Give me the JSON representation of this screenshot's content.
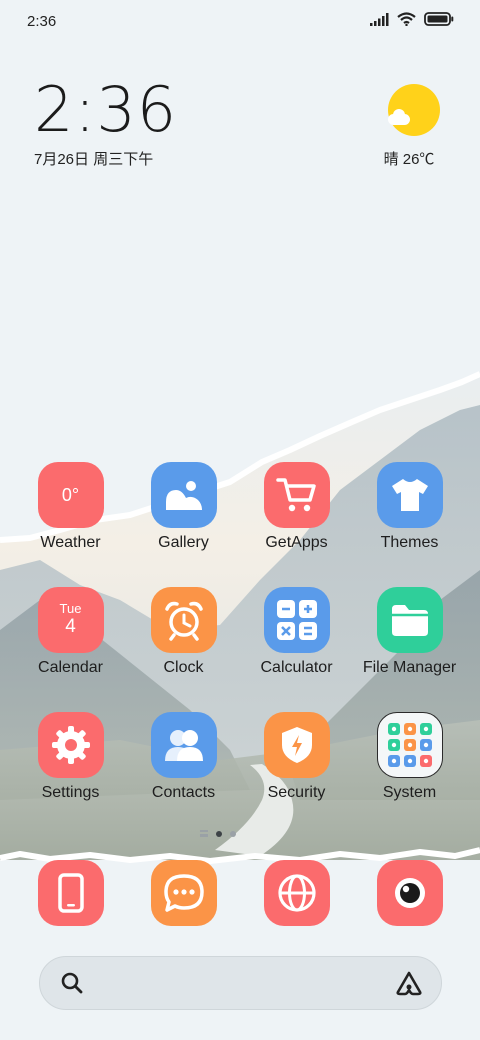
{
  "status": {
    "time": "2:36"
  },
  "clock": {
    "time": "2:36",
    "date": "7月26日 周三下午"
  },
  "weather": {
    "text": "晴 26℃"
  },
  "apps": [
    {
      "label": "Weather",
      "icon": "weather-app-icon",
      "color": "#fb6b6d",
      "badge": "0°"
    },
    {
      "label": "Gallery",
      "icon": "gallery-icon",
      "color": "#5a9bea"
    },
    {
      "label": "GetApps",
      "icon": "shopping-cart-icon",
      "color": "#fb6b6d"
    },
    {
      "label": "Themes",
      "icon": "tshirt-icon",
      "color": "#5a9bea"
    },
    {
      "label": "Calendar",
      "icon": "calendar-icon",
      "color": "#fb6b6d",
      "day": "Tue",
      "date": "4"
    },
    {
      "label": "Clock",
      "icon": "alarm-clock-icon",
      "color": "#fb9447"
    },
    {
      "label": "Calculator",
      "icon": "calculator-icon",
      "color": "#5a9bea"
    },
    {
      "label": "File Manager",
      "icon": "folder-icon",
      "color": "#2fcf9a"
    },
    {
      "label": "Settings",
      "icon": "gear-icon",
      "color": "#fb6b6d"
    },
    {
      "label": "Contacts",
      "icon": "contacts-icon",
      "color": "#5a9bea"
    },
    {
      "label": "Security",
      "icon": "shield-icon",
      "color": "#fb9447"
    },
    {
      "label": "System",
      "icon": "folder-grid-icon",
      "color": "#f4f7f8"
    }
  ],
  "dock": [
    {
      "icon": "phone-icon",
      "color": "#fb6b6d"
    },
    {
      "icon": "messages-icon",
      "color": "#fb9447"
    },
    {
      "icon": "browser-globe-icon",
      "color": "#fb6b6d"
    },
    {
      "icon": "camera-icon",
      "color": "#fb6b6d"
    }
  ],
  "search": {
    "left_icon": "search-icon",
    "right_icon": "assistant-icon"
  }
}
